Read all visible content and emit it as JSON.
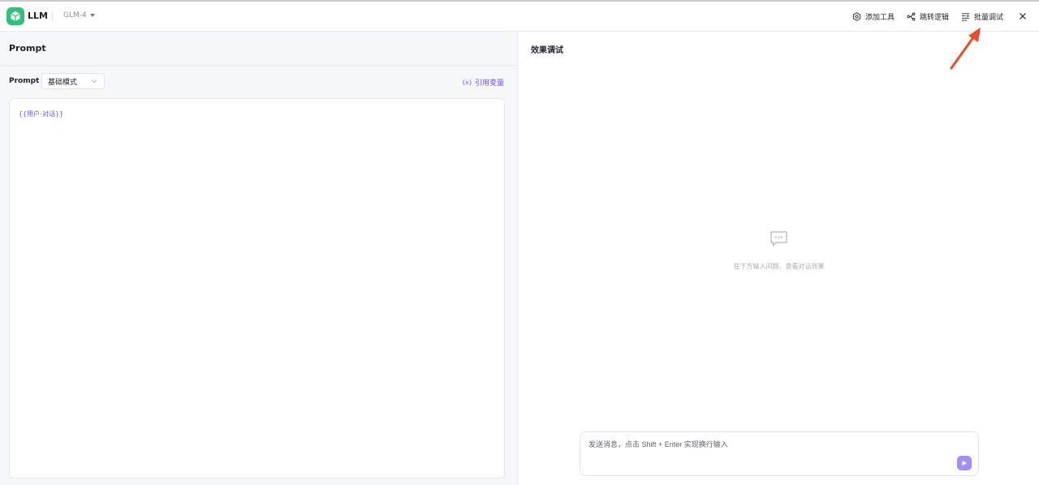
{
  "header": {
    "app_name": "LLM",
    "model": "GLM-4",
    "add_tool": "添加工具",
    "jump_logic": "跳转逻辑",
    "batch_debug": "批量调试",
    "icons": [
      "gear-icon",
      "branch-icon",
      "list-icon",
      "close-icon"
    ]
  },
  "left": {
    "title": "Prompt",
    "prompt_label": "Prompt",
    "mode": "基础模式",
    "ref_var_prefix": "{x}",
    "ref_var": "引用变量",
    "editor_content": "{{用户-对话}}"
  },
  "right": {
    "title": "效果调试",
    "empty_hint": "在下方输入问题，查看对话效果",
    "input_placeholder": "发送消息，点击 Shift + Enter 实现换行输入"
  },
  "colors": {
    "accent": "#6e4ff6",
    "logo": "#2fc07a",
    "send": "#a58cf7",
    "annotation": "#f04a2a"
  }
}
